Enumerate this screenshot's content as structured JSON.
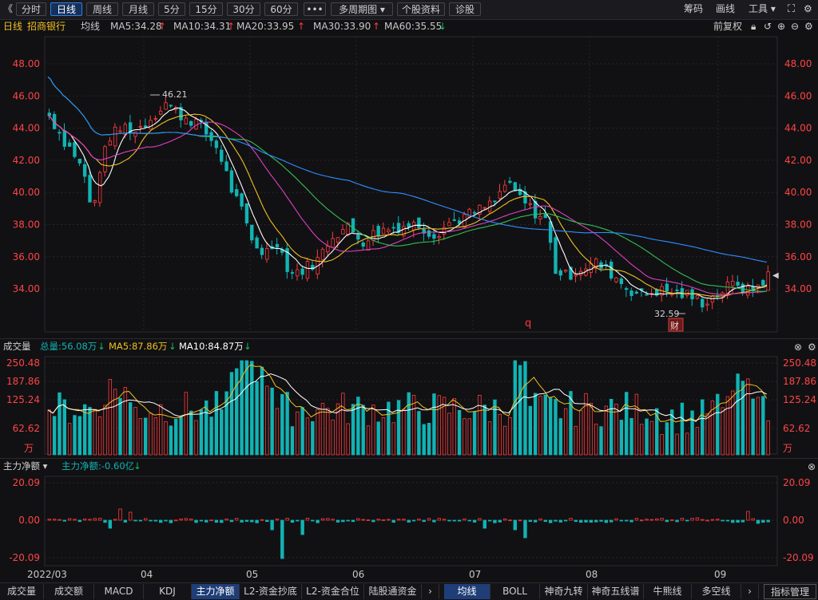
{
  "toolbar": {
    "nav_arrow": "《",
    "periods": [
      "分时",
      "日线",
      "周线",
      "月线",
      "5分",
      "15分",
      "30分",
      "60分"
    ],
    "active_period": 1,
    "more": "•••",
    "multi_period": "多周期图",
    "stock_info": "个股资料",
    "diagnosis": "诊股",
    "right": [
      "筹码",
      "画线",
      "工具"
    ]
  },
  "legend": {
    "period": "日线",
    "stock": "招商银行",
    "ma_label": "均线",
    "ma": [
      {
        "text": "MA5:34.28",
        "color": "#ffffff"
      },
      {
        "text": "MA10:34.31",
        "color": "#f0c020"
      },
      {
        "text": "MA20:33.95",
        "color": "#e040c0"
      },
      {
        "text": "MA30:33.90",
        "color": "#30c050"
      },
      {
        "text": "MA60:35.55",
        "color": "#2f8fff"
      }
    ],
    "adjust": "前复权"
  },
  "price_axis": [
    "48.00",
    "46.00",
    "44.00",
    "42.00",
    "40.00",
    "38.00",
    "36.00",
    "34.00"
  ],
  "annotations": {
    "high": "46.21",
    "low": "32.59",
    "marker_q": "q",
    "marker_cai": "财"
  },
  "volume_panel": {
    "title": "成交量",
    "total": "总量:56.08万",
    "ma5": "MA5:87.86万",
    "ma10": "MA10:84.87万",
    "axis": [
      "250.48",
      "187.86",
      "125.24",
      "62.62"
    ],
    "unit": "万"
  },
  "flow_panel": {
    "title": "主力净额",
    "value": "主力净额:-0.60亿",
    "axis": [
      "20.09",
      "0.00",
      "-20.09"
    ]
  },
  "xaxis": [
    "2022/03",
    "04",
    "05",
    "06",
    "07",
    "08",
    "09"
  ],
  "bottom_tabs": [
    "成交量",
    "成交额",
    "MACD",
    "KDJ",
    "主力净额",
    "L2-资金抄底",
    "L2-资金合位",
    "陆股通资金"
  ],
  "bottom_tabs_active": 4,
  "bottom_right_tabs": [
    "均线",
    "BOLL",
    "神奇九转",
    "神奇五线谱",
    "牛熊线",
    "多空线"
  ],
  "bottom_right_active": 0,
  "indicator_manage": "指标管理",
  "colors": {
    "up": "#ff3b3b",
    "down": "#12b3b3"
  }
}
